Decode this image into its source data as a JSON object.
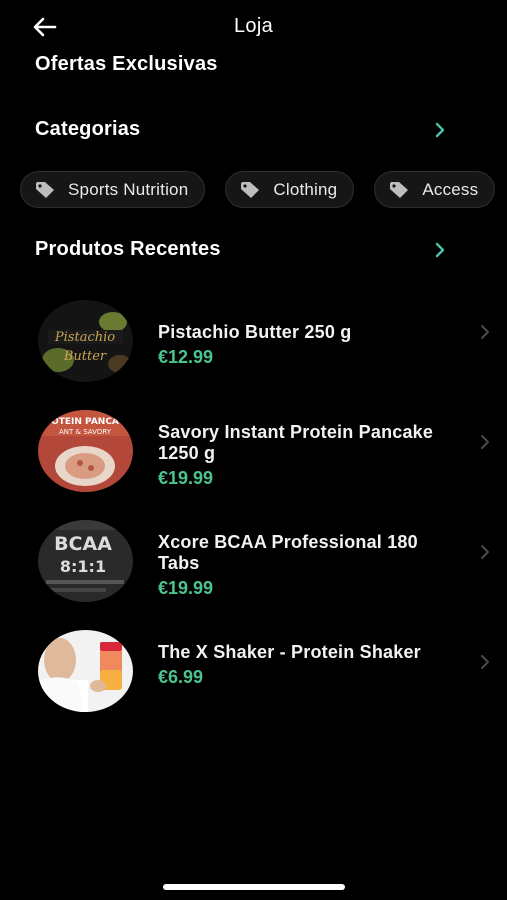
{
  "header": {
    "title": "Loja",
    "back_icon": "arrow-left-icon"
  },
  "sections": {
    "offers_title": "Ofertas Exclusivas",
    "categories_title": "Categorias",
    "recent_title": "Produtos Recentes"
  },
  "categories": [
    {
      "label": "Sports Nutrition",
      "icon": "tag-icon"
    },
    {
      "label": "Clothing",
      "icon": "tag-icon"
    },
    {
      "label": "Access",
      "icon": "tag-icon"
    }
  ],
  "products": [
    {
      "name": "Pistachio Butter 250 g",
      "price": "€12.99"
    },
    {
      "name": "Savory Instant Protein Pancake 1250 g",
      "price": "€19.99"
    },
    {
      "name": "Xcore BCAA Professional 180 Tabs",
      "price": "€19.99"
    },
    {
      "name": "The X Shaker - Protein Shaker",
      "price": "€6.99"
    }
  ],
  "colors": {
    "background": "#000000",
    "accent_arrow": "#4cc2a8",
    "price": "#4cc28f",
    "chip_bg": "#161616"
  }
}
